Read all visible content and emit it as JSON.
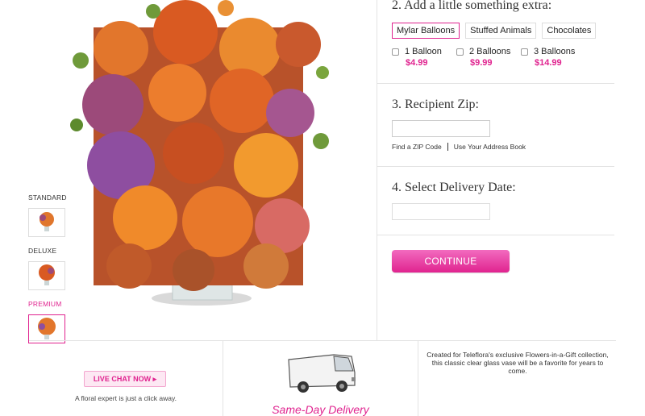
{
  "product": {
    "variants": [
      {
        "label": "STANDARD",
        "active": false
      },
      {
        "label": "DELUXE",
        "active": false
      },
      {
        "label": "PREMIUM",
        "active": true
      }
    ]
  },
  "step2": {
    "title": "2. Add a little something extra:",
    "tabs": [
      "Mylar Balloons",
      "Stuffed Animals",
      "Chocolates"
    ],
    "active_tab": "Mylar Balloons",
    "options": [
      {
        "label": "1 Balloon",
        "price": "$4.99"
      },
      {
        "label": "2 Balloons",
        "price": "$9.99"
      },
      {
        "label": "3 Balloons",
        "price": "$14.99"
      }
    ]
  },
  "step3": {
    "title": "3. Recipient Zip:",
    "zip_value": "",
    "link_find_zip": "Find a ZIP Code",
    "link_address_book": "Use Your Address Book"
  },
  "step4": {
    "title": "4. Select Delivery Date:",
    "date_value": ""
  },
  "continue_label": "CONTINUE",
  "bottom": {
    "chat_label": "LIVE CHAT NOW ▸",
    "chat_sub": "A floral expert is just a click away.",
    "delivery_label": "Same-Day Delivery",
    "description": "Created for Teleflora's exclusive Flowers-in-a-Gift collection, this classic clear glass vase will be a favorite for years to come."
  },
  "colors": {
    "accent": "#e0238f",
    "border": "#e3e3e3"
  }
}
